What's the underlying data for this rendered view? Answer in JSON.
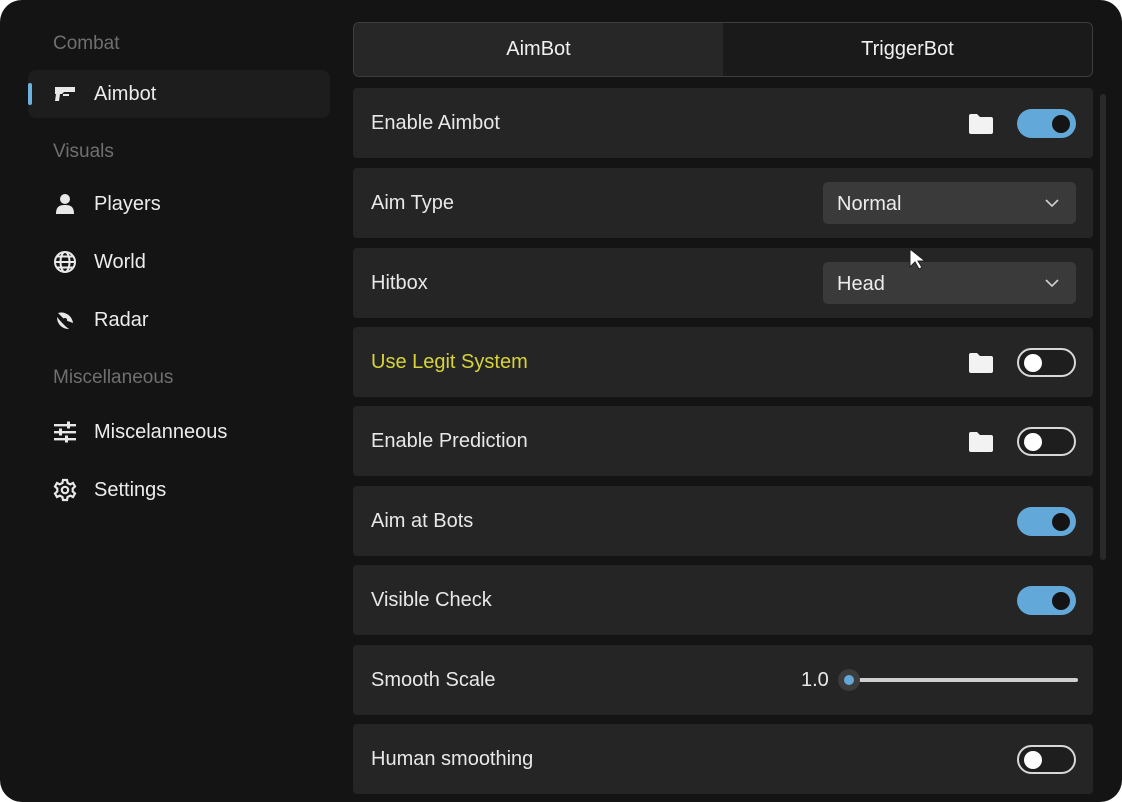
{
  "sidebar": {
    "sections": [
      {
        "label": "Combat"
      },
      {
        "label": "Visuals"
      },
      {
        "label": "Miscellaneous"
      }
    ],
    "items": [
      {
        "label": "Aimbot",
        "icon": "gun-icon",
        "active": true
      },
      {
        "label": "Players",
        "icon": "person-icon"
      },
      {
        "label": "World",
        "icon": "globe-icon"
      },
      {
        "label": "Radar",
        "icon": "radar-icon"
      },
      {
        "label": "Miscelanneous",
        "icon": "sliders-icon"
      },
      {
        "label": "Settings",
        "icon": "gear-icon"
      }
    ]
  },
  "tabs": [
    {
      "label": "AimBot",
      "active": true
    },
    {
      "label": "TriggerBot",
      "active": false
    }
  ],
  "rows": {
    "enable_aimbot": {
      "label": "Enable Aimbot",
      "toggle": "on"
    },
    "aim_type": {
      "label": "Aim Type",
      "value": "Normal"
    },
    "hitbox": {
      "label": "Hitbox",
      "value": "Head"
    },
    "use_legit_system": {
      "label": "Use Legit System",
      "toggle": "off"
    },
    "enable_prediction": {
      "label": "Enable Prediction",
      "toggle": "off"
    },
    "aim_at_bots": {
      "label": "Aim at Bots",
      "toggle": "on"
    },
    "visible_check": {
      "label": "Visible Check",
      "toggle": "on"
    },
    "smooth_scale": {
      "label": "Smooth Scale",
      "value": "1.0",
      "slider_fraction": 0
    },
    "human_smoothing": {
      "label": "Human smoothing",
      "toggle": "off"
    }
  },
  "colors": {
    "accent": "#62a8d9",
    "highlight_text": "#d7d43a",
    "background": "#141414",
    "row_background": "#252525"
  }
}
